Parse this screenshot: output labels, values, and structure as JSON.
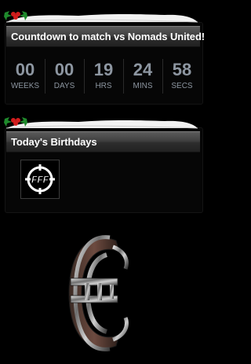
{
  "countdown": {
    "title": "Countdown to match vs Nomads United!",
    "units": [
      {
        "value": "00",
        "label": "WEEKS"
      },
      {
        "value": "00",
        "label": "DAYS"
      },
      {
        "value": "19",
        "label": "HRS"
      },
      {
        "value": "24",
        "label": "MINS"
      },
      {
        "value": "58",
        "label": "SECS"
      }
    ]
  },
  "birthdays": {
    "title": "Today's Birthdays",
    "logo_text": "FFF"
  },
  "decoration": {
    "holly_icon": "holly-icon",
    "snow": "snow-drift"
  },
  "colors": {
    "background": "#000000",
    "header_gradient_top": "#5b5b5b",
    "header_gradient_bottom": "#222222",
    "timer_text": "#8d96a1",
    "holly_leaf": "#1f8a2c",
    "holly_berry": "#d11d1d"
  }
}
